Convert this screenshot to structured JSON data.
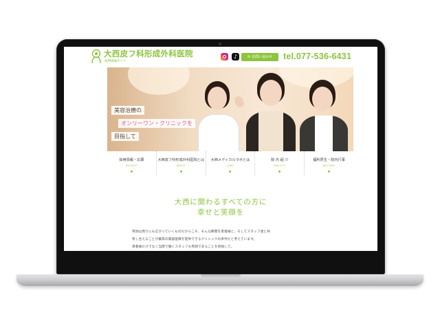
{
  "site": {
    "logo_title": "大西皮フ科形成外科医院",
    "logo_sub": "採用情報サイト",
    "social": [
      {
        "name": "instagram",
        "icon": "instagram-icon"
      },
      {
        "name": "tiktok",
        "icon": "tiktok-icon",
        "glyph": "♪"
      }
    ],
    "contact_label": "お問い合わせ",
    "tel": "tel.077-536-6431",
    "accent_color": "#8cc43c"
  },
  "hero": {
    "line1": "美容治療の",
    "line2": "オンリーワン・クリニックを",
    "line3": "目指して"
  },
  "nav": {
    "items": [
      {
        "label": "採用情報・応募",
        "en": "RECRUIT"
      },
      {
        "label": "大西皮フ科形成外科医院とは",
        "en": "ABOUT"
      },
      {
        "label": "大西メディカルラボとは",
        "en": "LABO"
      },
      {
        "label": "院 内 紹 介",
        "en": "FACILITY"
      },
      {
        "label": "福利厚生・院内行事",
        "en": "WELFARE"
      }
    ]
  },
  "intro": {
    "heading_line1": "大西に関わるすべての方に",
    "heading_line2": "幸せと笑顔を",
    "text": [
      "笑顔は周りにも広がっていくものだからこそ、そんな瞬間を患者様と、そしてスタッフ達と共",
      "有し合えることが最高の美容医療を提供できるクリニックの条件だと考えています。",
      "患者様だけでなく当院で働くスタッフも笑顔であることを目指して。"
    ]
  }
}
